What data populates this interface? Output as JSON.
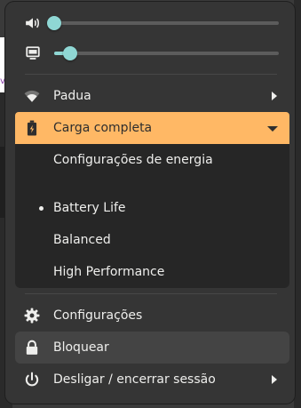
{
  "sliders": {
    "volume": {
      "icon": "speaker-volume-icon",
      "level": 0.0
    },
    "brightness": {
      "icon": "display-brightness-icon",
      "level": 0.07
    }
  },
  "wifi": {
    "icon": "wifi-icon",
    "label": "Padua"
  },
  "battery": {
    "icon": "battery-full-icon",
    "label": "Carga completa",
    "accent": "#ffb865",
    "submenu": {
      "settings_label": "Configurações de energia",
      "modes": [
        {
          "label": "Battery Life",
          "selected": true
        },
        {
          "label": "Balanced",
          "selected": false
        },
        {
          "label": "High Performance",
          "selected": false
        }
      ]
    }
  },
  "actions": {
    "settings": {
      "icon": "gear-icon",
      "label": "Configurações"
    },
    "lock": {
      "icon": "lock-icon",
      "label": "Bloquear"
    },
    "power": {
      "icon": "power-icon",
      "label": "Desligar / encerrar sessão"
    }
  },
  "colors": {
    "slider_accent": "#8fd7d4",
    "menu_bg": "#353535",
    "submenu_bg": "#262626"
  },
  "background_fragments": [
    "v3"
  ]
}
